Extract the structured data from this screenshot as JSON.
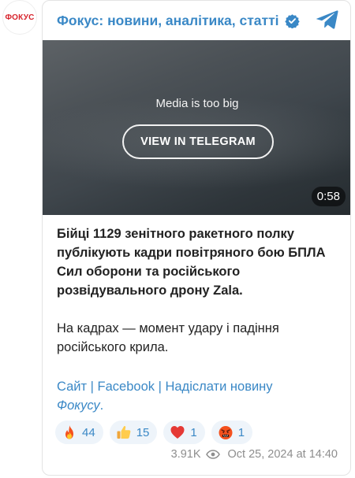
{
  "avatar": {
    "text": "ФОКУС"
  },
  "header": {
    "channel_name": "Фокус: новини, аналітика, статті",
    "verified_icon": "verified-badge-icon",
    "telegram_icon": "telegram-logo-icon"
  },
  "media": {
    "message": "Media is too big",
    "button_label": "VIEW IN TELEGRAM",
    "duration": "0:58"
  },
  "post": {
    "paragraph1": "Бійці 1129 зенітного ракетного полку публікують кадри повітряного бою БПЛА Сил оборони та російського розвідувального дрону Zala.",
    "paragraph2": "На кадрах — момент удару і падіння російського крила."
  },
  "links": {
    "site": "Сайт",
    "sep1": " | ",
    "facebook": "Facebook",
    "sep2": " | ",
    "send_news": "Надіслати новину",
    "focus": "Фокусу",
    "dot": "."
  },
  "reactions": [
    {
      "icon": "fire-icon",
      "count": "44"
    },
    {
      "icon": "thumbs-up-icon",
      "count": "15"
    },
    {
      "icon": "red-heart-icon",
      "count": "1"
    },
    {
      "icon": "angry-face-icon",
      "count": "1"
    }
  ],
  "meta": {
    "views": "3.91K",
    "eye_icon": "eye-icon",
    "timestamp": "Oct 25, 2024 at 14:40"
  },
  "colors": {
    "accent": "#3a88c6",
    "brand_red": "#d7232c",
    "reaction_bg": "#eef4fa",
    "meta_gray": "#8e8e8e"
  }
}
